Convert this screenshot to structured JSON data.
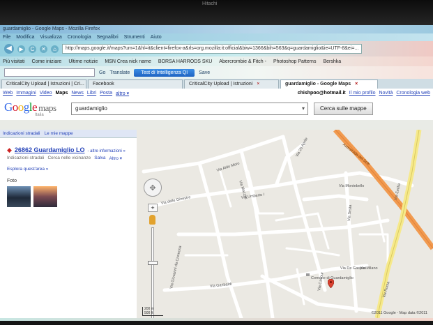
{
  "bezel": {
    "brand": "Hitachi"
  },
  "window": {
    "title": "guardamiglio - Google Maps - Mozilla Firefox"
  },
  "menu": [
    "File",
    "Modifica",
    "Visualizza",
    "Cronologia",
    "Segnalibri",
    "Strumenti",
    "Aiuto"
  ],
  "nav": {
    "url": "http://maps.google.it/maps?um=1&hl=it&client=firefox-a&rls=org.mozilla:it:official&biw=1366&bih=563&q=guardamiglio&ie=UTF-8&ei=...",
    "back_glyph": "◀",
    "forward_glyph": "▶",
    "reload_glyph": "C",
    "stop_glyph": "✕",
    "home_glyph": "⌂"
  },
  "bookmarks": [
    "Più visitati",
    "Come iniziare",
    "Ultime notizie",
    "MSN Crea nick name",
    "BORSA HARRODS SKU",
    "Abercrombie & Fitch -",
    "Photoshop Patterns",
    "Bershka"
  ],
  "toolbar2": {
    "go": "Go",
    "translate": "Translate",
    "iq_test": "Test di Intelligenza QI",
    "save": "Save"
  },
  "tabs": [
    {
      "title": "CriticalCity Upload | Istruzioni | Cri...",
      "close": ""
    },
    {
      "title": "Facebook",
      "close": ""
    },
    {
      "title": "CriticalCity Upload | Istruzioni",
      "close": "×"
    },
    {
      "title": "guardamiglio - Google Maps",
      "close": "×"
    }
  ],
  "gbar": {
    "links": [
      "Web",
      "Immagini",
      "Video",
      "Maps",
      "News",
      "Libri",
      "Posta",
      "altro ▾"
    ],
    "email": "chishpoo@hotmail.it",
    "profile": "Il mio profilo",
    "help": "Novità",
    "history": "Cronologia web"
  },
  "search": {
    "logo_maps": "maps",
    "logo_country": "Italia",
    "query": "guardamiglio",
    "dropdown": "▾",
    "button": "Cerca sulle mappe"
  },
  "sidebar": {
    "tabs": [
      "Indicazioni stradali",
      "Le mie mappe"
    ],
    "result": {
      "marker": "◆",
      "title": "26862 Guardamiglio LO",
      "info": "- altre informazioni »",
      "actions": [
        "Indicazioni stradali",
        "Cerca nelle vicinanze",
        "Salva",
        "Altro ▾"
      ],
      "explore": "Esplora quest'area »"
    },
    "photos_label": "Foto"
  },
  "map": {
    "streets": [
      {
        "name": "Via Aldo Moro"
      },
      {
        "name": "Via delle Ginestre"
      },
      {
        "name": "Via Umberto I"
      },
      {
        "name": "Via Mazzini"
      },
      {
        "name": "Via Garibaldi"
      },
      {
        "name": "Via 25 Aprile"
      },
      {
        "name": "Via Montebello"
      },
      {
        "name": "Via Roma"
      },
      {
        "name": "Via Cavour"
      },
      {
        "name": "Via De Gasperi"
      },
      {
        "name": "Via Giovanni da Cremona"
      },
      {
        "name": "Via Emilia"
      },
      {
        "name": "Via Sesta"
      },
      {
        "name": "Via Milano"
      }
    ],
    "highway": "Autostrada del Sole",
    "poi": "Comune di Guardamiglio",
    "copyright": "©2011 Google - Map data ©2011",
    "scale_top": "200 m",
    "scale_bottom": "500 ft",
    "pan": "✥",
    "zoom_in": "+"
  }
}
